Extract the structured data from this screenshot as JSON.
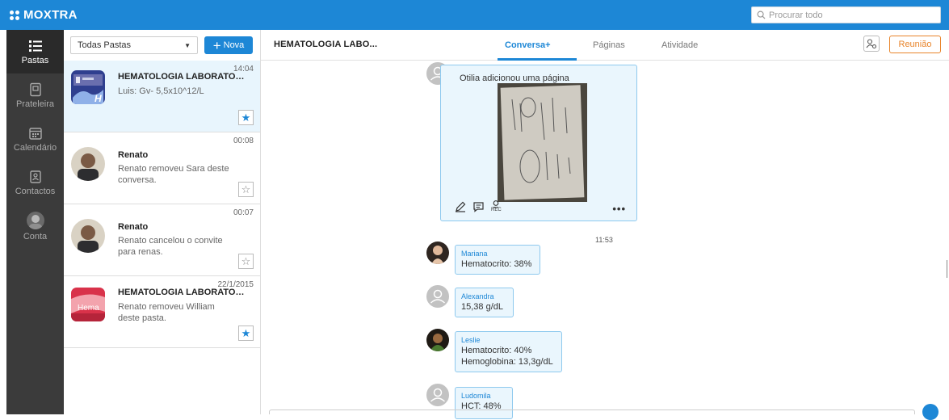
{
  "app": {
    "logo": "MOXTRA"
  },
  "search": {
    "placeholder": "Procurar todo"
  },
  "leftnav": [
    {
      "label": "Pastas",
      "icon": "list-icon"
    },
    {
      "label": "Prateleira",
      "icon": "shelf-icon"
    },
    {
      "label": "Calendário",
      "icon": "calendar-icon"
    },
    {
      "label": "Contactos",
      "icon": "contacts-icon"
    },
    {
      "label": "Conta",
      "icon": "account-avatar"
    }
  ],
  "list": {
    "filter": "Todas Pastas",
    "new_label": "Nova",
    "items": [
      {
        "title": "HEMATOLOGIA LABORATORI...",
        "sub": "Luis: Gv- 5,5x10^12/L",
        "time": "14:04",
        "starred": true
      },
      {
        "title": "Renato",
        "sub": "Renato removeu Sara deste conversa.",
        "time": "00:08",
        "starred": false
      },
      {
        "title": "Renato",
        "sub": "Renato cancelou o convite para renas.",
        "time": "00:07",
        "starred": false
      },
      {
        "title": "HEMATOLOGIA LABORATORI...",
        "sub": "Renato removeu William deste pasta.",
        "time": "22/1/2015",
        "starred": true
      }
    ],
    "thumb_text": {
      "item0": "H",
      "item3": "Hema"
    }
  },
  "main": {
    "title": "HEMATOLOGIA LABO...",
    "tabs": [
      "Conversa+",
      "Páginas",
      "Atividade"
    ],
    "meeting_label": "Reunião",
    "card": {
      "text": "Otilia adicionou uma página",
      "rec_label": "REC",
      "more": "•••"
    },
    "timestamp": "11:53",
    "messages": [
      {
        "name": "Mariana",
        "lines": [
          "Hematocrito: 38%"
        ]
      },
      {
        "name": "Alexandra",
        "lines": [
          "15,38 g/dL"
        ]
      },
      {
        "name": "Leslie",
        "lines": [
          "Hematocrito: 40%",
          "Hemoglobina: 13,3g/dL"
        ]
      },
      {
        "name": "Ludomila",
        "lines": [
          "HCT: 48%"
        ]
      }
    ]
  },
  "colors": {
    "brand": "#1d87d6",
    "meeting": "#e8842a",
    "nav_bg": "#3b3b3b",
    "bubble_bg": "#eaf6fd",
    "bubble_border": "#8ec9ee"
  }
}
